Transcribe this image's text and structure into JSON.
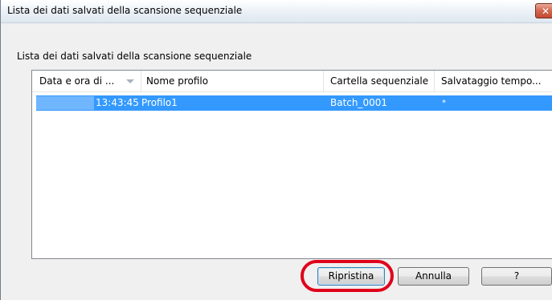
{
  "window": {
    "title": "Lista dei dati salvati della scansione sequenziale",
    "close_label": "✕"
  },
  "main": {
    "section_label": "Lista dei dati salvati della scansione sequenziale"
  },
  "list": {
    "columns": [
      {
        "label": "Data e ora di ..."
      },
      {
        "label": "Nome profilo"
      },
      {
        "label": "Cartella sequenziale"
      },
      {
        "label": "Salvataggio tempo..."
      }
    ],
    "rows": [
      {
        "time": "13:43:45",
        "profile": "Profilo1",
        "folder": "Batch_0001",
        "temporary": "*",
        "selected": true
      }
    ]
  },
  "buttons": {
    "restore_label": "Ripristina",
    "cancel_label": "Annulla",
    "help_label": "?"
  },
  "colors": {
    "selection": "#3399ff",
    "highlight_ring": "#e0001b"
  }
}
